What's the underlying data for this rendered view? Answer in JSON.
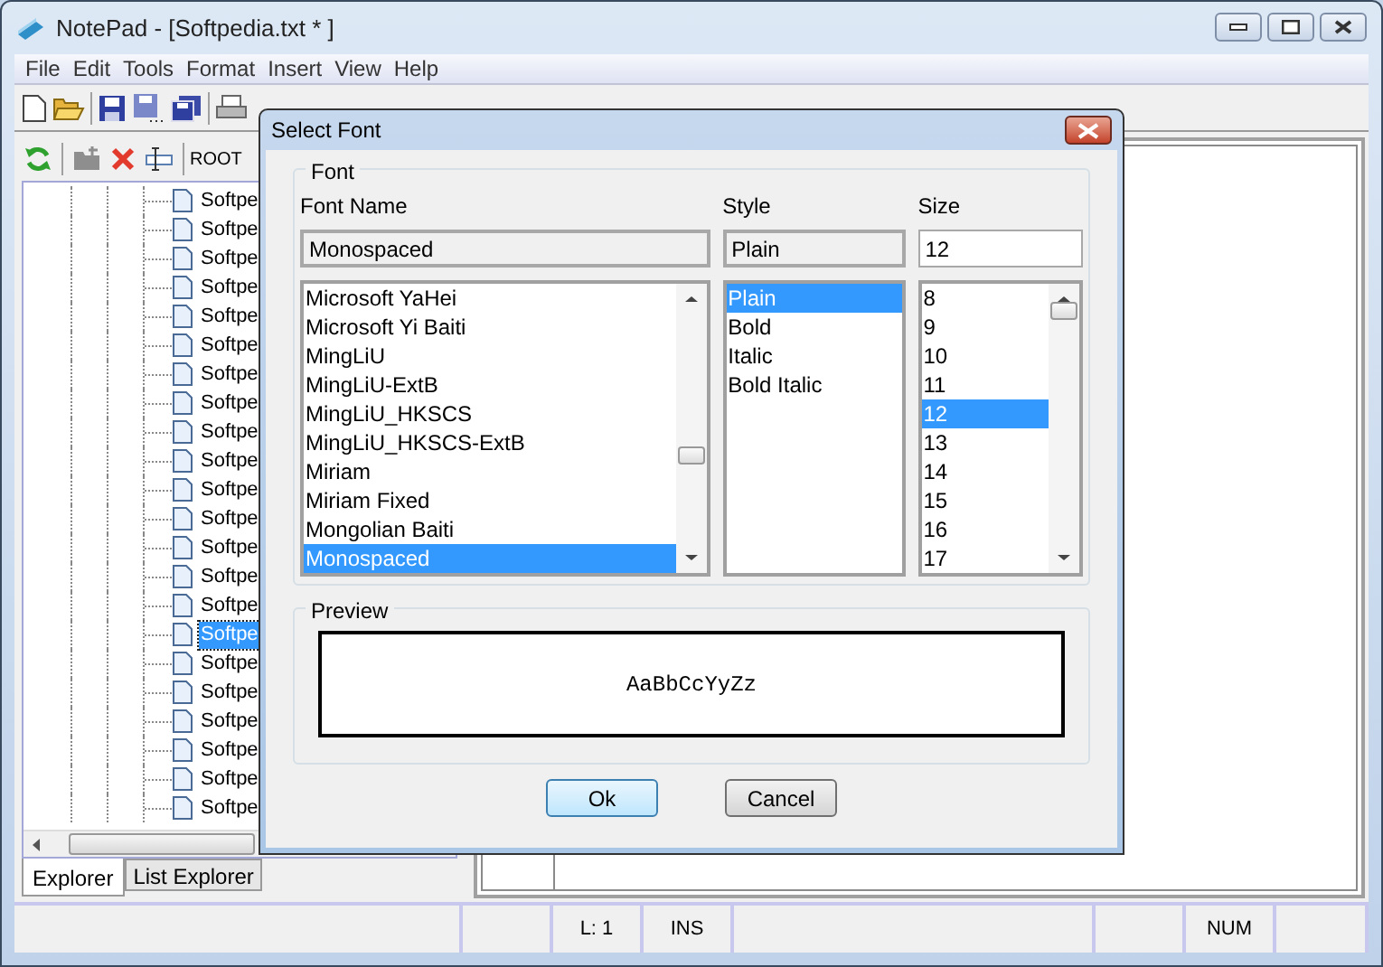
{
  "window": {
    "title": "NotePad - [Softpedia.txt * ]"
  },
  "menu": [
    "File",
    "Edit",
    "Tools",
    "Format",
    "Insert",
    "View",
    "Help"
  ],
  "explorer": {
    "root_label": "ROOT",
    "items": [
      {
        "label": "Softpe",
        "selected": false
      },
      {
        "label": "Softpe",
        "selected": false
      },
      {
        "label": "Softpe",
        "selected": false
      },
      {
        "label": "Softpe",
        "selected": false
      },
      {
        "label": "Softpe",
        "selected": false
      },
      {
        "label": "Softpe",
        "selected": false
      },
      {
        "label": "Softpe",
        "selected": false
      },
      {
        "label": "Softpe",
        "selected": false
      },
      {
        "label": "Softpe",
        "selected": false
      },
      {
        "label": "Softpe",
        "selected": false
      },
      {
        "label": "Softpe",
        "selected": false
      },
      {
        "label": "Softpe",
        "selected": false
      },
      {
        "label": "Softpe",
        "selected": false
      },
      {
        "label": "Softpe",
        "selected": false
      },
      {
        "label": "Softpe",
        "selected": false
      },
      {
        "label": "Softpe",
        "selected": true
      },
      {
        "label": "Softpe",
        "selected": false
      },
      {
        "label": "Softpe",
        "selected": false
      },
      {
        "label": "Softpe",
        "selected": false
      },
      {
        "label": "Softpe",
        "selected": false
      },
      {
        "label": "Softpe",
        "selected": false
      },
      {
        "label": "Softpe",
        "selected": false
      }
    ],
    "tabs": [
      {
        "label": "Explorer",
        "selected": true
      },
      {
        "label": "List Explorer",
        "selected": false
      }
    ]
  },
  "status_bar": [
    "L: 1",
    "INS",
    "NUM"
  ],
  "dialog": {
    "title": "Select Font",
    "group_label": "Font",
    "font_name": {
      "label": "Font Name",
      "value": "Monospaced",
      "items": [
        {
          "label": "Microsoft YaHei",
          "selected": false
        },
        {
          "label": "Microsoft Yi Baiti",
          "selected": false
        },
        {
          "label": "MingLiU",
          "selected": false
        },
        {
          "label": "MingLiU-ExtB",
          "selected": false
        },
        {
          "label": "MingLiU_HKSCS",
          "selected": false
        },
        {
          "label": "MingLiU_HKSCS-ExtB",
          "selected": false
        },
        {
          "label": "Miriam",
          "selected": false
        },
        {
          "label": "Miriam Fixed",
          "selected": false
        },
        {
          "label": "Mongolian Baiti",
          "selected": false
        },
        {
          "label": "Monospaced",
          "selected": true
        }
      ]
    },
    "style": {
      "label": "Style",
      "value": "Plain",
      "items": [
        {
          "label": "Plain",
          "selected": true
        },
        {
          "label": "Bold",
          "selected": false
        },
        {
          "label": "Italic",
          "selected": false
        },
        {
          "label": "Bold Italic",
          "selected": false
        }
      ]
    },
    "size": {
      "label": "Size",
      "value": "12",
      "items": [
        {
          "label": "8",
          "selected": false
        },
        {
          "label": "9",
          "selected": false
        },
        {
          "label": "10",
          "selected": false
        },
        {
          "label": "11",
          "selected": false
        },
        {
          "label": "12",
          "selected": true
        },
        {
          "label": "13",
          "selected": false
        },
        {
          "label": "14",
          "selected": false
        },
        {
          "label": "15",
          "selected": false
        },
        {
          "label": "16",
          "selected": false
        },
        {
          "label": "17",
          "selected": false
        }
      ]
    },
    "preview_label": "Preview",
    "preview_text": "AaBbCcYyZz",
    "buttons": [
      {
        "label": "Ok",
        "kind": "default"
      },
      {
        "label": "Cancel",
        "kind": "normal"
      }
    ]
  }
}
